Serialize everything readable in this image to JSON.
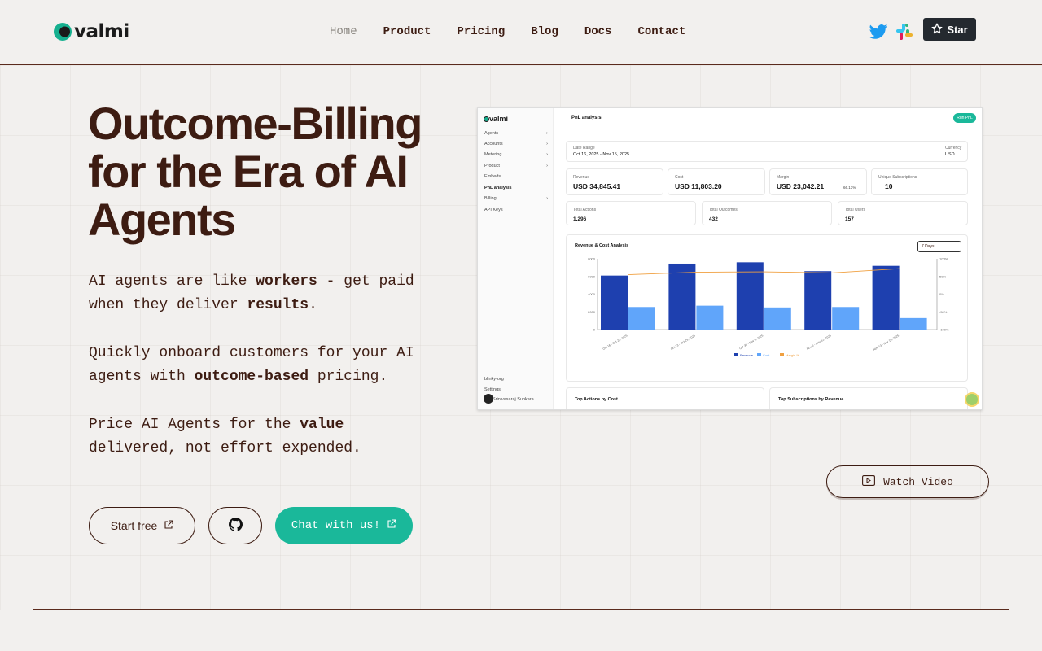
{
  "brand": {
    "name": "valmi",
    "accent": "#1ab89a"
  },
  "nav": {
    "items": [
      {
        "label": "Home",
        "active": true
      },
      {
        "label": "Product",
        "active": false
      },
      {
        "label": "Pricing",
        "active": false
      },
      {
        "label": "Blog",
        "active": false
      },
      {
        "label": "Docs",
        "active": false
      },
      {
        "label": "Contact",
        "active": false
      }
    ],
    "star_label": "Star"
  },
  "hero": {
    "title": "Outcome-Billing for the Era of AI Agents",
    "p1": [
      "AI agents are like ",
      "workers",
      " - get paid when they deliver ",
      "results",
      "."
    ],
    "p2": [
      "Quickly onboard customers for your AI agents with ",
      "outcome-based",
      " pricing."
    ],
    "p3": [
      "Price AI Agents for the ",
      "value",
      " delivered, not effort expended."
    ],
    "start_label": "Start free",
    "chat_label": "Chat with us!",
    "video_label": "Watch Video"
  },
  "dashboard": {
    "logo": "valmi",
    "page_title": "PnL analysis",
    "run_button": "Run PnL",
    "sidebar": [
      {
        "label": "Agents",
        "chevron": true
      },
      {
        "label": "Accounts",
        "chevron": true
      },
      {
        "label": "Metering",
        "chevron": true
      },
      {
        "label": "Product",
        "chevron": true
      },
      {
        "label": "Embeds",
        "chevron": false
      },
      {
        "label": "PnL analysis",
        "chevron": false
      },
      {
        "label": "Billing",
        "chevron": true
      },
      {
        "label": "API Keys",
        "chevron": false
      }
    ],
    "org": "blinky-org",
    "settings": "Settings",
    "user": "Srinivasaraj Sunkara",
    "date_range_label": "Date Range",
    "date_range": "Oct 16, 2025 - Nov 15, 2025",
    "currency_label": "Currency",
    "currency": "USD",
    "metrics": [
      {
        "label": "Revenue",
        "value": "USD 34,845.41"
      },
      {
        "label": "Cost",
        "value": "USD 11,803.20"
      },
      {
        "label": "Margin",
        "value": "USD 23,042.21",
        "extra": "66.13%"
      },
      {
        "label": "Unique Subscriptions",
        "value": "10"
      }
    ],
    "totals": [
      {
        "label": "Total Actions",
        "value": "1,296"
      },
      {
        "label": "Total Outcomes",
        "value": "432"
      },
      {
        "label": "Total Users",
        "value": "157"
      }
    ],
    "chart_title": "Revenue & Cost Analysis",
    "period": "7 Days",
    "bottom_left": "Top Actions by Cost",
    "bottom_right": "Top Subscriptions by Revenue"
  },
  "chart_data": {
    "type": "bar",
    "title": "Revenue & Cost Analysis",
    "categories": [
      "Oct 16 - Oct 22, 2025",
      "Oct 23 - Oct 29, 2025",
      "Oct 30 - Nov 5, 2025",
      "Nov 6 - Nov 12, 2025",
      "Nov 13 - Nov 15, 2025"
    ],
    "series": [
      {
        "name": "Revenue",
        "color": "#1e40af",
        "values": [
          6100,
          7450,
          7600,
          6600,
          7200
        ]
      },
      {
        "name": "Cost",
        "color": "#60a5fa",
        "values": [
          2550,
          2700,
          2500,
          2550,
          1300
        ]
      },
      {
        "name": "Margin %",
        "color": "#f0a040",
        "values": [
          55,
          62,
          63,
          60,
          72
        ]
      }
    ],
    "y_ticks": [
      "8000",
      "6000",
      "4000",
      "2000",
      "0"
    ],
    "y2_ticks": [
      "100%",
      "50%",
      "0%",
      "-50%",
      "-100%"
    ],
    "ylim": [
      0,
      8000
    ]
  }
}
